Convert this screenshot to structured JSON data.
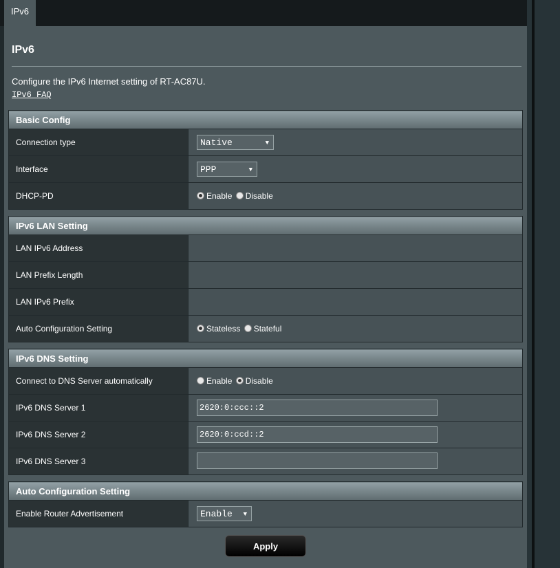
{
  "tab": {
    "label": "IPv6"
  },
  "page": {
    "title": "IPv6",
    "description": "Configure the IPv6 Internet setting of RT-AC87U.",
    "faq_link": "IPv6 FAQ"
  },
  "basic_config": {
    "header": "Basic Config",
    "connection_type": {
      "label": "Connection type",
      "value": "Native"
    },
    "interface": {
      "label": "Interface",
      "value": "PPP"
    },
    "dhcp_pd": {
      "label": "DHCP-PD",
      "enable_label": "Enable",
      "disable_label": "Disable",
      "selected": "Enable"
    }
  },
  "lan_setting": {
    "header": "IPv6 LAN Setting",
    "lan_ipv6_address": {
      "label": "LAN IPv6 Address",
      "value": ""
    },
    "lan_prefix_length": {
      "label": "LAN Prefix Length",
      "value": ""
    },
    "lan_ipv6_prefix": {
      "label": "LAN IPv6 Prefix",
      "value": ""
    },
    "auto_config": {
      "label": "Auto Configuration Setting",
      "stateless_label": "Stateless",
      "stateful_label": "Stateful",
      "selected": "Stateless"
    }
  },
  "dns_setting": {
    "header": "IPv6 DNS Setting",
    "auto_dns": {
      "label": "Connect to DNS Server automatically",
      "enable_label": "Enable",
      "disable_label": "Disable",
      "selected": "Disable"
    },
    "dns1": {
      "label": "IPv6 DNS Server 1",
      "value": "2620:0:ccc::2"
    },
    "dns2": {
      "label": "IPv6 DNS Server 2",
      "value": "2620:0:ccd::2"
    },
    "dns3": {
      "label": "IPv6 DNS Server 3",
      "value": ""
    }
  },
  "auto_config_setting": {
    "header": "Auto Configuration Setting",
    "router_adv": {
      "label": "Enable Router Advertisement",
      "value": "Enable"
    }
  },
  "apply_label": "Apply"
}
